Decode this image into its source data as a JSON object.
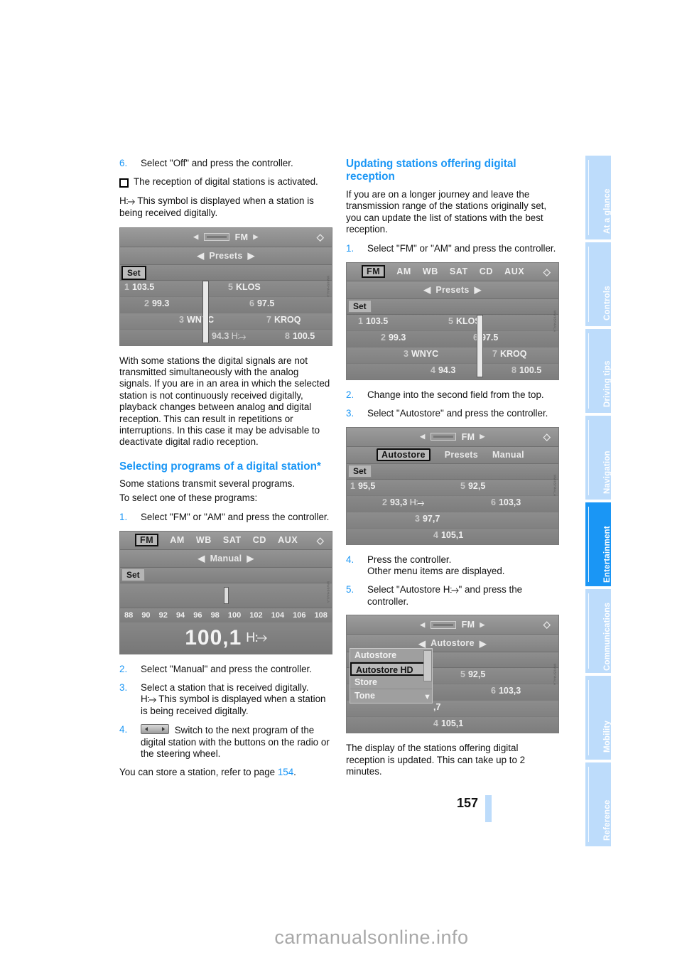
{
  "page": {
    "number": "157",
    "watermark": "carmanualsonline.info"
  },
  "sidebar": {
    "items": [
      {
        "label": "At a glance",
        "active": false
      },
      {
        "label": "Controls",
        "active": false
      },
      {
        "label": "Driving tips",
        "active": false
      },
      {
        "label": "Navigation",
        "active": false
      },
      {
        "label": "Entertainment",
        "active": true
      },
      {
        "label": "Communications",
        "active": false
      },
      {
        "label": "Mobility",
        "active": false
      },
      {
        "label": "Reference",
        "active": false
      }
    ],
    "accent_active": "#1a96f5",
    "accent_inactive": "#bddcfb"
  },
  "left_column": {
    "step6": {
      "num": "6.",
      "text": "Select \"Off\" and press the controller."
    },
    "bullet_activated": "The reception of digital stations is activated.",
    "hd_note": "This symbol is displayed when a station is being received digitally.",
    "hd_symbol": "HD",
    "figure_presets": {
      "caption_code": "MW05H4ALA",
      "topbar_label": "FM",
      "menu_label": "Presets",
      "set_label": "Set",
      "presets": [
        {
          "index": "1",
          "value": "103.5"
        },
        {
          "index": "5",
          "value": "KLOS"
        },
        {
          "index": "2",
          "value": "99.3"
        },
        {
          "index": "6",
          "value": "97.5"
        },
        {
          "index": "3",
          "value": "WNYC"
        },
        {
          "index": "7",
          "value": "KROQ"
        },
        {
          "index": "4",
          "value": "94.3"
        },
        {
          "index": "8",
          "value": "100.5"
        }
      ]
    },
    "paragraph_analog": "With some stations the digital signals are not transmitted simultaneously with the analog signals. If you are in an area in which the selected station is not continuously received digitally, playback changes between analog and digital reception. This can result in repetitions or interruptions. In this case it may be advisable to deactivate digital radio reception.",
    "heading_selecting": "Selecting programs of a digital station*",
    "intro_line1": "Some stations transmit several programs.",
    "intro_line2": "To select one of these programs:",
    "step1": {
      "num": "1.",
      "text": "Select \"FM\" or \"AM\" and press the controller."
    },
    "figure_manual": {
      "caption_code": "MW05H4ALA",
      "sources": [
        "FM",
        "AM",
        "WB",
        "SAT",
        "CD",
        "AUX"
      ],
      "selected_source": "FM",
      "menu_label": "Manual",
      "set_label": "Set",
      "scale_ticks": [
        "88",
        "90",
        "92",
        "94",
        "96",
        "98",
        "100",
        "102",
        "104",
        "106",
        "108"
      ],
      "frequency": "100,1",
      "hd_symbol": "HD"
    },
    "step2": {
      "num": "2.",
      "text": "Select \"Manual\" and press the controller."
    },
    "step3": {
      "num": "3.",
      "text_a": "Select a station that is received digitally.",
      "text_b": "This symbol is displayed when a station is being received digitally."
    },
    "step4": {
      "num": "4.",
      "text": "Switch to the next program of the digital station with the buttons on the radio or the steering wheel."
    },
    "store_note_a": "You can store a station, refer to page ",
    "store_note_page": "154",
    "store_note_b": "."
  },
  "right_column": {
    "heading_updating": "Updating stations offering digital reception",
    "paragraph_journey": "If you are on a longer journey and leave the transmission range of the stations originally set, you can update the list of stations with the best reception.",
    "step1": {
      "num": "1.",
      "text": "Select \"FM\" or \"AM\" and press the controller."
    },
    "figure_presets2": {
      "caption_code": "MW05H4ALA",
      "sources": [
        "FM",
        "AM",
        "WB",
        "SAT",
        "CD",
        "AUX"
      ],
      "selected_source": "FM",
      "menu_label": "Presets",
      "set_label": "Set",
      "presets": [
        {
          "index": "1",
          "value": "103.5"
        },
        {
          "index": "5",
          "value": "KLOS"
        },
        {
          "index": "2",
          "value": "99.3"
        },
        {
          "index": "6",
          "value": "97.5"
        },
        {
          "index": "3",
          "value": "WNYC"
        },
        {
          "index": "7",
          "value": "KROQ"
        },
        {
          "index": "4",
          "value": "94.3"
        },
        {
          "index": "8",
          "value": "100.5"
        }
      ]
    },
    "step2": {
      "num": "2.",
      "text": "Change into the second field from the top."
    },
    "step3": {
      "num": "3.",
      "text": "Select \"Autostore\" and press the controller."
    },
    "figure_autostore": {
      "caption_code": "MW05H4ALA",
      "topbar_label": "FM",
      "menu_items": [
        "Autostore",
        "Presets",
        "Manual"
      ],
      "menu_selected": "Autostore",
      "set_label": "Set",
      "presets": [
        {
          "index": "1",
          "value": "95,5"
        },
        {
          "index": "5",
          "value": "92,5"
        },
        {
          "index": "2",
          "value": "93,3",
          "hd": "HD"
        },
        {
          "index": "6",
          "value": "103,3"
        },
        {
          "index": "3",
          "value": "97,7"
        },
        {
          "index": "4",
          "value": "105,1"
        }
      ]
    },
    "step4": {
      "num": "4.",
      "text_a": "Press the controller.",
      "text_b": "Other menu items are displayed."
    },
    "step5": {
      "num": "5.",
      "text_a": "Select \"Autostore ",
      "hd_symbol": "HD",
      "text_b": "\" and press the controller."
    },
    "figure_menu": {
      "caption_code": "MW05H4ALA",
      "topbar_label": "FM",
      "menu_label": "Autostore",
      "popup_items": [
        "Autostore",
        "Autostore HD",
        "Store",
        "Tone"
      ],
      "popup_selected": "Autostore HD",
      "presets": [
        {
          "index": "5",
          "value": "92,5"
        },
        {
          "index": "6",
          "value": "103,3"
        },
        {
          "index": "",
          "value": ",7"
        },
        {
          "index": "4",
          "value": "105,1"
        }
      ]
    },
    "closing_paragraph": "The display of the stations offering digital reception is updated. This can take up to 2 minutes."
  }
}
